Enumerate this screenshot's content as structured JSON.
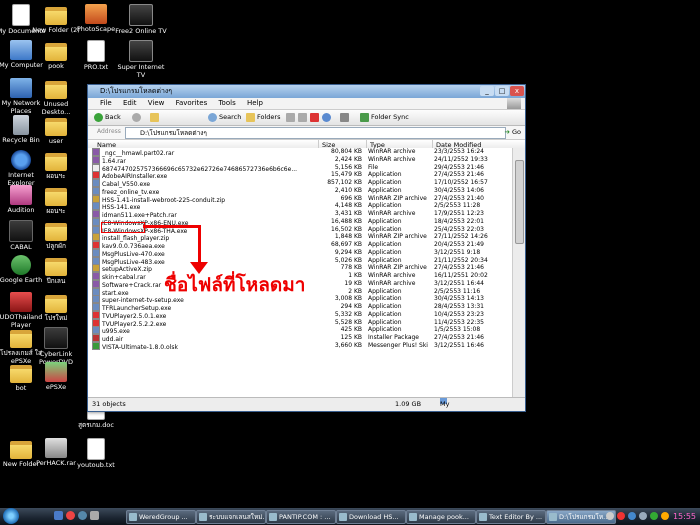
{
  "desktop_icons": [
    {
      "label": "My Documents",
      "icon": "my-documents-icon"
    },
    {
      "label": "New Folder (2)",
      "icon": "folder-icon"
    },
    {
      "label": "PhotoScape",
      "icon": "photoscape-icon"
    },
    {
      "label": "Free2 Online TV",
      "icon": "tv-icon"
    },
    {
      "label": "My Computer",
      "icon": "computer-icon"
    },
    {
      "label": "pook",
      "icon": "folder-icon"
    },
    {
      "label": "PRO.txt",
      "icon": "text-file-icon"
    },
    {
      "label": "Super Internet TV",
      "icon": "tv-icon"
    },
    {
      "label": "My Network Places",
      "icon": "network-icon"
    },
    {
      "label": "Unused Deskto...",
      "icon": "folder-icon"
    },
    {
      "label": "Recycle Bin",
      "icon": "recycle-bin-icon"
    },
    {
      "label": "user",
      "icon": "folder-icon"
    },
    {
      "label": "Internet Explorer",
      "icon": "internet-explorer-icon"
    },
    {
      "label": "ผอนฯะ",
      "icon": "folder-icon"
    },
    {
      "label": "Audition",
      "icon": "audition-icon"
    },
    {
      "label": "ผอนฯะ",
      "icon": "folder-icon"
    },
    {
      "label": "CABAL",
      "icon": "cabal-icon"
    },
    {
      "label": "ปลูกผัก",
      "icon": "folder-icon"
    },
    {
      "label": "Google Earth",
      "icon": "google-earth-icon"
    },
    {
      "label": "ปีกเลน",
      "icon": "folder-icon"
    },
    {
      "label": "UDOThailand Player",
      "icon": "player-icon"
    },
    {
      "label": "โปรใหม่",
      "icon": "folder-icon"
    },
    {
      "label": "โปรลงเกมส์ ใส่ ePSXe",
      "icon": "folder-icon"
    },
    {
      "label": "CyberLink PowerDVD",
      "icon": "powerdvd-icon"
    },
    {
      "label": "bot",
      "icon": "folder-icon"
    },
    {
      "label": "ePSXe",
      "icon": "epsxe-icon"
    },
    {
      "label": "สูตรเกม.doc",
      "icon": "word-document-icon"
    },
    {
      "label": "New Folder",
      "icon": "folder-icon"
    },
    {
      "label": "PerHACK.rar",
      "icon": "rar-archive-icon"
    },
    {
      "label": "youtoub.txt",
      "icon": "text-file-icon"
    }
  ],
  "window": {
    "title": "D:\\โปรแกรมโหลดต่างๆ",
    "menu": [
      "File",
      "Edit",
      "View",
      "Favorites",
      "Tools",
      "Help"
    ],
    "toolbar": {
      "back": "Back",
      "search": "Search",
      "folders": "Folders",
      "folder_sync": "Folder Sync"
    },
    "address_label": "Address",
    "address": "D:\\โปรแกรมโหลดต่างๆ",
    "go": "Go",
    "columns": [
      "Name",
      "Size",
      "Type",
      "Date Modified"
    ],
    "files": [
      {
        "name": "_ngc__hmawl.part02.rar",
        "size": "80,804 KB",
        "type": "WinRAR archive",
        "date": "23/3/2553 16:24",
        "icon": "rar"
      },
      {
        "name": "1.64.rar",
        "size": "2,424 KB",
        "type": "WinRAR archive",
        "date": "24/11/2552 19:33",
        "icon": "rar"
      },
      {
        "name": "6874747025757366696c65732e62726e74686572736e6b6c6e...",
        "size": "5,156 KB",
        "type": "File",
        "date": "29/4/2553 21:46",
        "icon": "file"
      },
      {
        "name": "AdobeAIRInstaller.exe",
        "size": "15,479 KB",
        "type": "Application",
        "date": "27/4/2553 21:46",
        "icon": "exe-red"
      },
      {
        "name": "Cabal_V550.exe",
        "size": "857,102 KB",
        "type": "Application",
        "date": "17/10/2552 16:57",
        "icon": "exe"
      },
      {
        "name": "freez_online_tv.exe",
        "size": "2,410 KB",
        "type": "Application",
        "date": "30/4/2553 14:06",
        "icon": "exe"
      },
      {
        "name": "HSS-1.41-install-webroot-225-conduit.zip",
        "size": "696 KB",
        "type": "WinRAR ZIP archive",
        "date": "27/4/2553 21:40",
        "icon": "zip"
      },
      {
        "name": "HSS-141.exe",
        "size": "4,148 KB",
        "type": "Application",
        "date": "2/5/2553 11:28",
        "icon": "exe"
      },
      {
        "name": "idman511.exe+Patch.rar",
        "size": "3,431 KB",
        "type": "WinRAR archive",
        "date": "17/9/2551 12:23",
        "icon": "rar"
      },
      {
        "name": "IE8-WindowsXP-x86-ENU.exe",
        "size": "16,488 KB",
        "type": "Application",
        "date": "18/4/2553 22:01",
        "icon": "exe"
      },
      {
        "name": "IE8-WindowsXP-x86-THA.exe",
        "size": "16,502 KB",
        "type": "Application",
        "date": "25/4/2553 22:03",
        "icon": "exe"
      },
      {
        "name": "install_flash_player.zip",
        "size": "1,848 KB",
        "type": "WinRAR ZIP archive",
        "date": "27/11/2552 14:26",
        "icon": "zip"
      },
      {
        "name": "kav9.0.0.736aea.exe",
        "size": "68,697 KB",
        "type": "Application",
        "date": "20/4/2553 21:49",
        "icon": "exe-red"
      },
      {
        "name": "MsgPlusLive-470.exe",
        "size": "9,294 KB",
        "type": "Application",
        "date": "3/12/2551 9:18",
        "icon": "exe"
      },
      {
        "name": "MsgPlusLive-483.exe",
        "size": "5,026 KB",
        "type": "Application",
        "date": "21/11/2552 20:34",
        "icon": "exe"
      },
      {
        "name": "setupActiveX.zip",
        "size": "778 KB",
        "type": "WinRAR ZIP archive",
        "date": "27/4/2553 21:46",
        "icon": "zip"
      },
      {
        "name": "skin+cabal.rar",
        "size": "1 KB",
        "type": "WinRAR archive",
        "date": "16/11/2551 20:02",
        "icon": "rar"
      },
      {
        "name": "Software+Crack.rar",
        "size": "19 KB",
        "type": "WinRAR archive",
        "date": "3/12/2551 16:44",
        "icon": "rar"
      },
      {
        "name": "start.exe",
        "size": "2 KB",
        "type": "Application",
        "date": "2/5/2553 11:16",
        "icon": "exe"
      },
      {
        "name": "super-internet-tv-setup.exe",
        "size": "3,008 KB",
        "type": "Application",
        "date": "30/4/2553 14:13",
        "icon": "exe"
      },
      {
        "name": "TFRLauncherSetup.exe",
        "size": "294 KB",
        "type": "Application",
        "date": "28/4/2553 13:31",
        "icon": "exe"
      },
      {
        "name": "TVUPlayer2.5.0.1.exe",
        "size": "5,332 KB",
        "type": "Application",
        "date": "10/4/2553 23:23",
        "icon": "exe-red"
      },
      {
        "name": "TVUPlayer2.5.2.2.exe",
        "size": "5,528 KB",
        "type": "Application",
        "date": "11/4/2553 22:35",
        "icon": "exe-red"
      },
      {
        "name": "u995.exe",
        "size": "425 KB",
        "type": "Application",
        "date": "1/5/2553 15:08",
        "icon": "exe"
      },
      {
        "name": "udd.air",
        "size": "125 KB",
        "type": "Installer Package",
        "date": "27/4/2553 21:46",
        "icon": "air"
      },
      {
        "name": "VISTA-Ultimate-1.8.0.olsk",
        "size": "3,660 KB",
        "type": "Messenger Plus! Ski...",
        "date": "3/12/2551 16:46",
        "icon": "msg"
      }
    ],
    "status": {
      "objects": "31 objects",
      "size": "1.09 GB",
      "location": "My Computer"
    }
  },
  "annotation": "ชื่อไฟล์ที่โหลดมา",
  "taskbar": {
    "tasks": [
      {
        "label": "WeredGroup ...",
        "active": false
      },
      {
        "label": "ระบบแจกเลนสใหม่...",
        "active": false
      },
      {
        "label": "PANTIP.COM : ...",
        "active": false
      },
      {
        "label": "Download HS...",
        "active": false
      },
      {
        "label": "Manage pook...",
        "active": false
      },
      {
        "label": "Text Editor By ...",
        "active": false
      },
      {
        "label": "D:\\โปรแกรมโห...",
        "active": true
      }
    ],
    "clock": "15:55"
  },
  "colors": {
    "annotation": "#ee0000",
    "clock": "#ff66cc"
  }
}
